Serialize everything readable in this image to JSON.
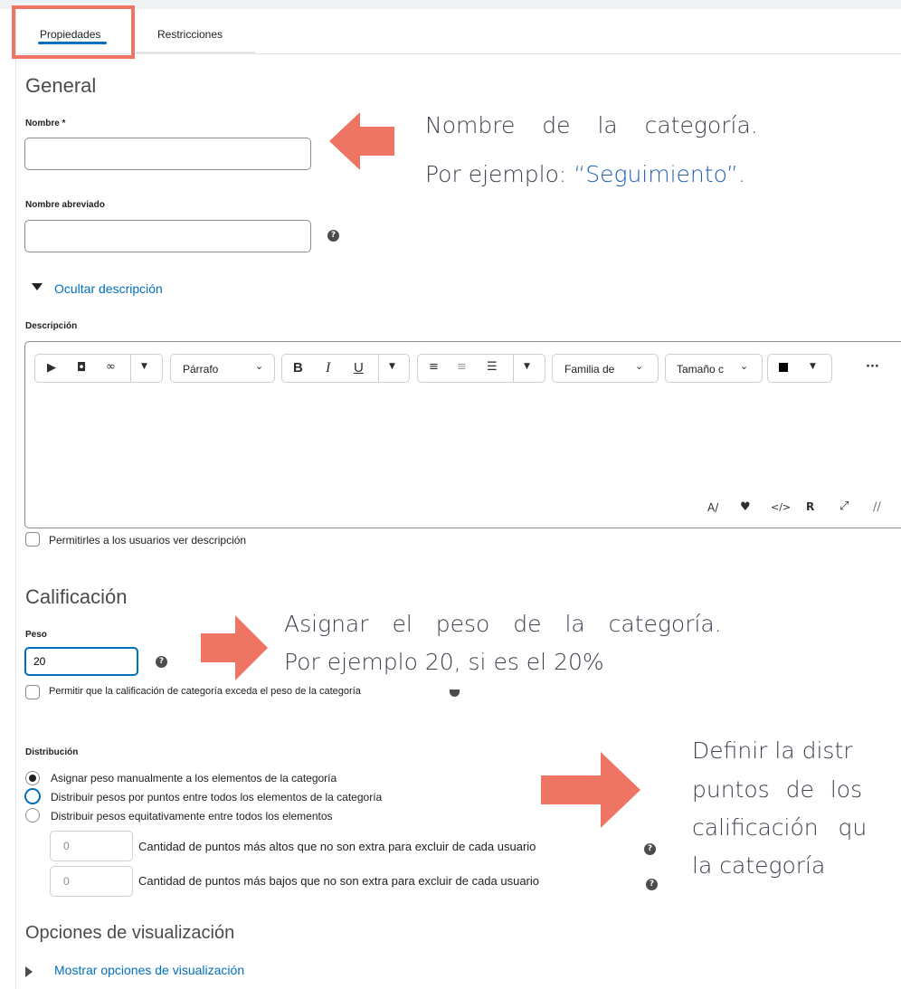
{
  "tabs": [
    {
      "label": "Propiedades"
    },
    {
      "label": "Restricciones"
    }
  ],
  "general": {
    "title": "General",
    "name_label": "Nombre *",
    "name_value": "",
    "short_name_label": "Nombre abreviado",
    "short_name_value": "",
    "toggle_description": "Ocultar descripción",
    "description_label": "Descripción",
    "allow_users_view": "Permitirles a los usuarios ver descripción"
  },
  "toolbar": {
    "paragraph": "Párrafo",
    "font_family": "Familia de",
    "font_size": "Tamaño c",
    "more": "···"
  },
  "grading": {
    "title": "Calificación",
    "weight_label": "Peso",
    "weight_value": "20",
    "exceed_label": "Permitir que la calificación de categoría exceda el peso de la categoría"
  },
  "distribution": {
    "label": "Distribución",
    "options": [
      "Asignar peso manualmente a los elementos de la categoría",
      "Distribuir pesos por puntos entre todos los elementos de la categoría",
      "Distribuir pesos equitativamente entre todos los elementos"
    ],
    "selected_index": 0,
    "drop_highest_value": "0",
    "drop_highest_label": "Cantidad de puntos más altos que no son extra para excluir de cada usuario",
    "drop_lowest_value": "0",
    "drop_lowest_label": "Cantidad de puntos más bajos que no son extra para excluir de cada usuario"
  },
  "display": {
    "title": "Opciones de visualización",
    "toggle": "Mostrar opciones de visualización"
  },
  "annotations": {
    "name_line1": "Nombre de la categoría.",
    "name_line2_prefix": "Por ejemplo: ",
    "name_line2_example": "“Seguimiento”.",
    "weight_line1": "Asignar el peso de la categoría.",
    "weight_line2": "Por ejemplo 20, si es el 20%",
    "dist_line1": "Definir la distr",
    "dist_line2": "puntos de los",
    "dist_line3": "calificación qu",
    "dist_line4": "la categoría"
  },
  "colors": {
    "accent": "#006fbf",
    "annotation_arrow": "#ee7463",
    "annotation_example": "#1f5fb4"
  }
}
